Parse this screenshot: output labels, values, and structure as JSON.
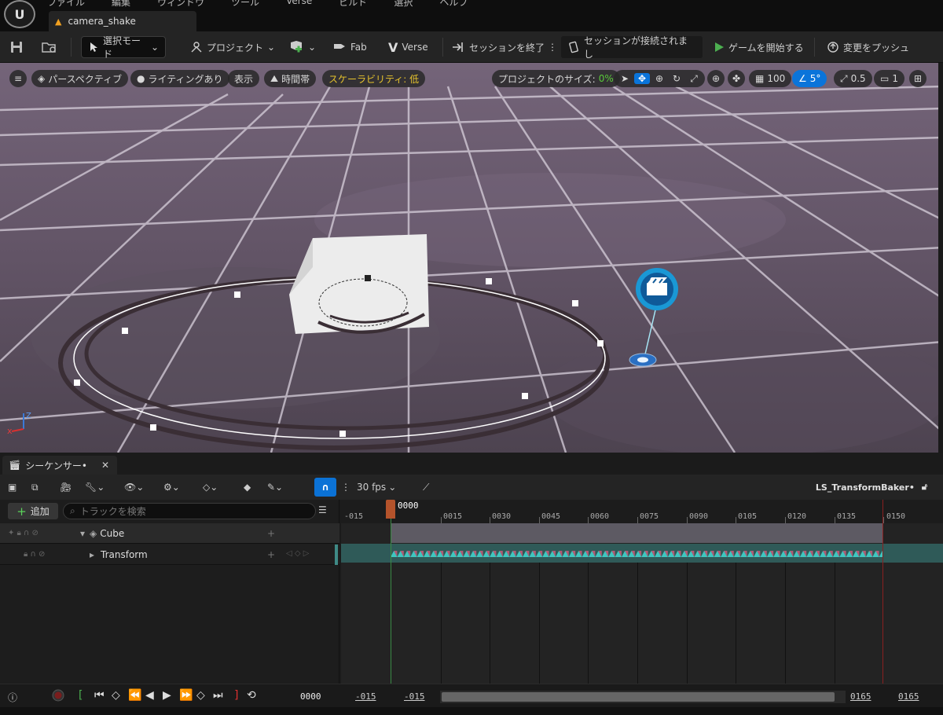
{
  "titlebar": {
    "menu": [
      "ファイル",
      "編集",
      "ウィンドウ",
      "ツール",
      "Verse",
      "ビルド",
      "選択",
      "ヘルプ"
    ],
    "doc_tab": "camera_shake"
  },
  "toolbar": {
    "select_mode": "選択モード",
    "project": "プロジェクト",
    "fab": "Fab",
    "verse": "Verse",
    "end_session": "セッションを終了",
    "session_connected": "セッションが接続されまし",
    "start_game": "ゲームを開始する",
    "push_changes": "変更をプッシュ"
  },
  "viewport": {
    "perspective": "パースペクティブ",
    "lighting": "ライティングあり",
    "show": "表示",
    "time_of_day": "時間帯",
    "scalability": "スケーラビリティ: 低",
    "project_size_label": "プロジェクトのサイズ:",
    "project_size_value": "0%",
    "grid_snap": "100",
    "rotation_snap": "5°",
    "scale_snap": "0.5",
    "camera_speed": "1",
    "axis_z": "Z",
    "accent": "#0a74da",
    "warning_color": "#e6c32d",
    "size_color": "#59c93a"
  },
  "sequencer": {
    "tab_label": "シーケンサー•",
    "fps": "30 fps",
    "sequence_name": "LS_TransformBaker•",
    "add_label": "追加",
    "search_placeholder": "トラックを検索",
    "tracks": [
      {
        "name": "Cube"
      },
      {
        "name": "Transform"
      }
    ],
    "current_frame": "0000",
    "ruler_ticks": [
      "-015",
      "0015",
      "0030",
      "0045",
      "0060",
      "0075",
      "0090",
      "0105",
      "0120",
      "0135",
      "0150"
    ],
    "footer": {
      "frame_readout": "0000",
      "view_start": "-015",
      "work_start": "-015",
      "view_end": "0165",
      "work_end": "0165"
    }
  }
}
